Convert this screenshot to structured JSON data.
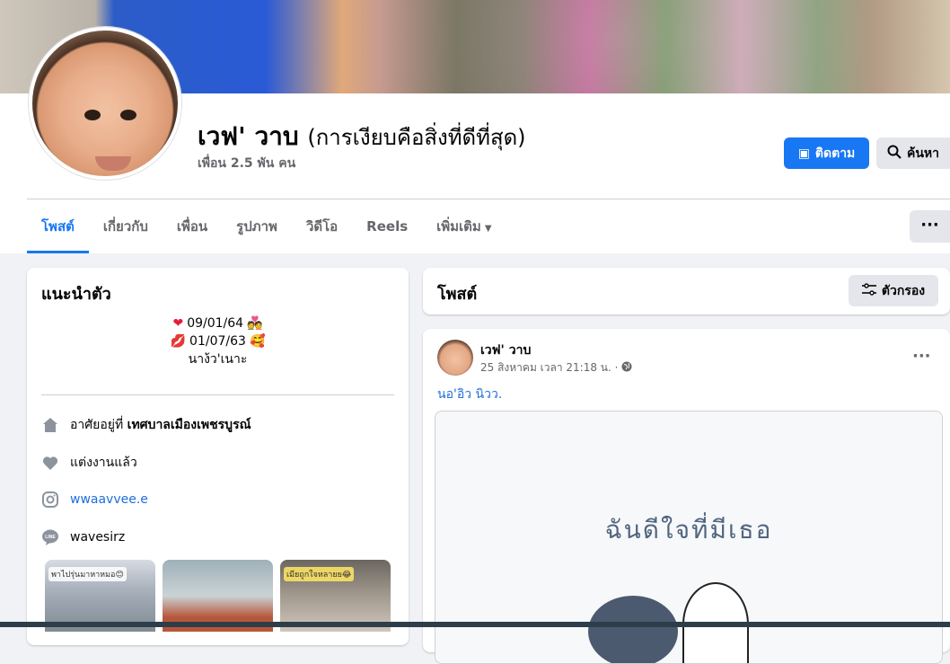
{
  "profile": {
    "name": "เวฟ' วาบ",
    "alt_name": "(การเงียบคือสิ่งที่ดีที่สุด)",
    "friends": "เพื่อน 2.5 พัน คน",
    "follow_label": "ติดตาม",
    "search_label": "ค้นหา"
  },
  "tabs": [
    {
      "label": "โพสต์"
    },
    {
      "label": "เกี่ยวกับ"
    },
    {
      "label": "เพื่อน"
    },
    {
      "label": "รูปภาพ"
    },
    {
      "label": "วิดีโอ"
    },
    {
      "label": "Reels"
    },
    {
      "label": "เพิ่มเติม"
    }
  ],
  "more_button": "···",
  "intro": {
    "title": "แนะนำตัว",
    "bio_line1": "09/01/64",
    "bio_line2": "01/07/63",
    "bio_line3": "นาง้ว'เนาะ",
    "lives_prefix": "อาศัยอยู่ที่",
    "lives_place": "เทศบาลเมืองเพชรบูรณ์",
    "relationship": "แต่งงานแล้ว",
    "instagram": "wwaavvee.e",
    "line": "wavesirz",
    "photos": [
      {
        "caption": "พาไปรุ่นมาหาหมอ😊"
      },
      {
        "caption": ""
      },
      {
        "caption": "เมียถูกใจหลายย😂"
      }
    ]
  },
  "posts_header": {
    "title": "โพสต์",
    "filter_label": "ตัวกรอง"
  },
  "post": {
    "author": "เวฟ' วาบ",
    "meta": "25 สิงหาคม เวลา 21:18 น. ·",
    "more": "···",
    "text": "นอ'อิว นิวว.",
    "image_text": "ฉันดีใจที่มีเธอ"
  }
}
